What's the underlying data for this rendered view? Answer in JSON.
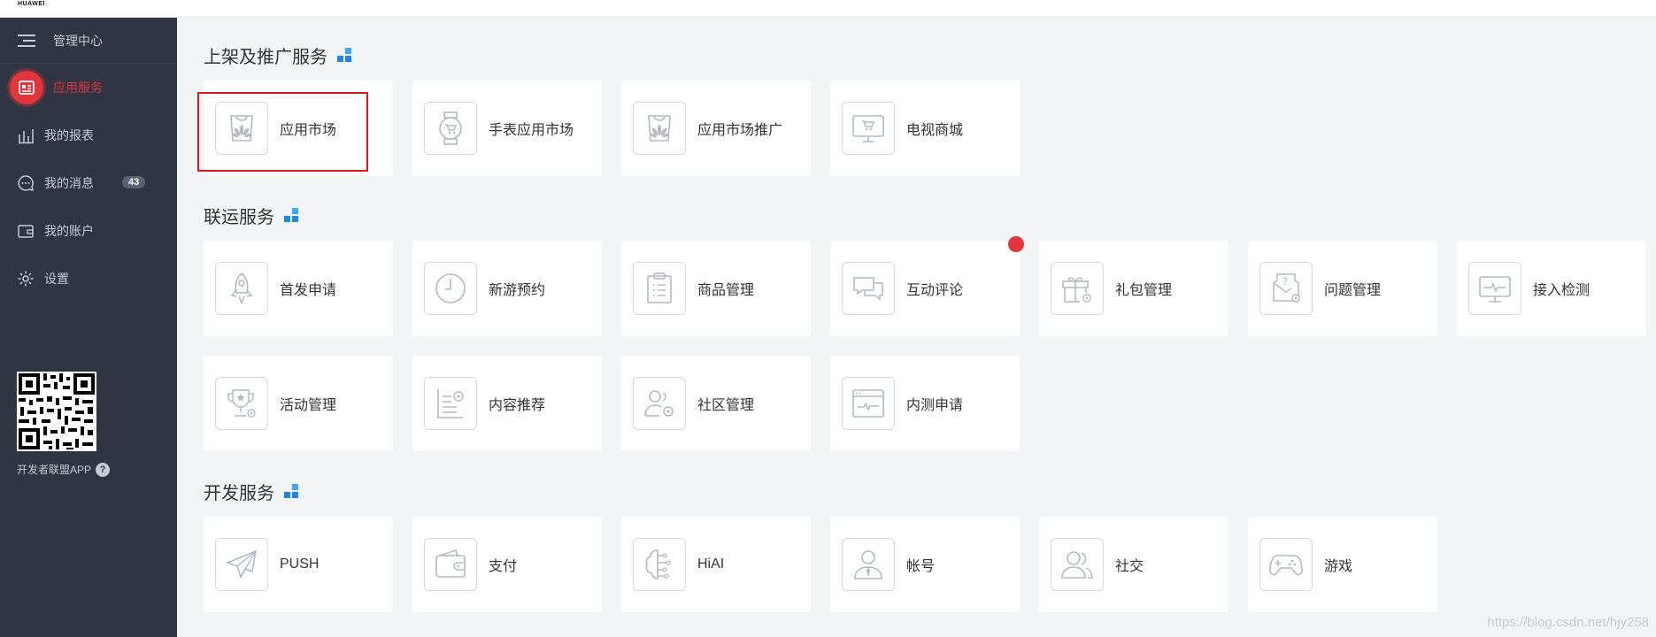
{
  "brand": "HUAWEI",
  "sidebar": {
    "header": "管理中心",
    "items": [
      {
        "label": "应用服务",
        "icon": "app-service-icon"
      },
      {
        "label": "我的报表",
        "icon": "bar-chart-icon"
      },
      {
        "label": "我的消息",
        "icon": "message-icon",
        "badge": "43"
      },
      {
        "label": "我的账户",
        "icon": "wallet-icon"
      },
      {
        "label": "设置",
        "icon": "gear-icon"
      }
    ],
    "qr_label": "开发者联盟APP",
    "help": "?"
  },
  "sections": [
    {
      "title": "上架及推广服务"
    },
    {
      "title": "联运服务"
    },
    {
      "title": "开发服务"
    }
  ],
  "cards": {
    "s1": [
      "应用市场",
      "手表应用市场",
      "应用市场推广",
      "电视商城"
    ],
    "s2": [
      "首发申请",
      "新游预约",
      "商品管理",
      "互动评论",
      "礼包管理",
      "问题管理",
      "接入检测"
    ],
    "s3": [
      "活动管理",
      "内容推荐",
      "社区管理",
      "内测申请"
    ],
    "s4": [
      "PUSH",
      "支付",
      "HiAI",
      "帐号",
      "社交",
      "游戏"
    ]
  },
  "colors": {
    "accent": "#e2353e",
    "sidebar_bg": "#2f3542",
    "section_icon_blue": "#1e88e5"
  },
  "watermark": "https://blog.csdn.net/hjy258"
}
